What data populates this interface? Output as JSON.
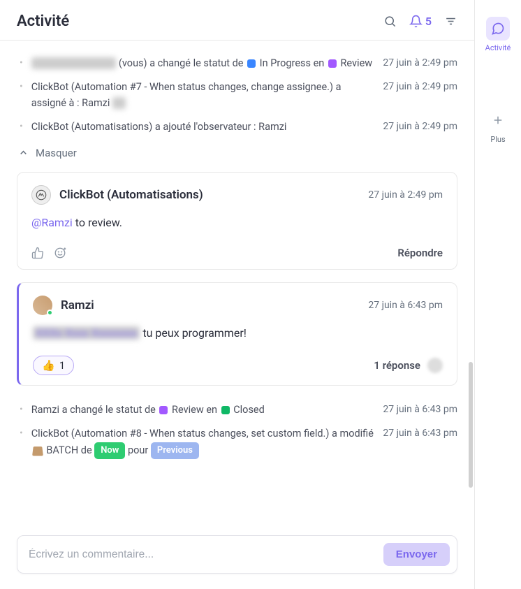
{
  "header": {
    "title": "Activité",
    "notif_count": "5"
  },
  "rail": {
    "activity_label": "Activité",
    "more_label": "Plus"
  },
  "hide_label": "Masquer",
  "activities_top": [
    {
      "prefix_blur": "Xx Xxxx Xxxxxxxx",
      "text_before": " (vous) a changé le statut de ",
      "dot1": "dot-blue",
      "status1": "In Progress",
      "mid": " en ",
      "dot2": "dot-purple",
      "status2": "Review",
      "time": "27 juin à 2:49 pm"
    },
    {
      "text": "ClickBot (Automation #7 - When status changes, change assignee.) a assigné à : Ramzi",
      "trailing_blur": true,
      "time": "27 juin à 2:49 pm"
    },
    {
      "text": "ClickBot (Automatisations) a ajouté l'observateur : Ramzi",
      "time": "27 juin à 2:49 pm"
    }
  ],
  "comment1": {
    "author": "ClickBot (Automatisations)",
    "time": "27 juin à 2:49 pm",
    "mention": "@Ramzi",
    "text": " to review.",
    "reply": "Répondre"
  },
  "comment2": {
    "author": "Ramzi",
    "time": "27 juin à 6:43 pm",
    "blur": "XXXx Xxxx Xxxxxxxx",
    "text": " tu peux programmer!",
    "reaction_emoji": "👍",
    "reaction_count": "1",
    "thread": "1 réponse"
  },
  "activities_bottom": [
    {
      "prefix": "Ramzi a changé le statut de ",
      "dot1": "dot-purple",
      "status1": "Review",
      "mid": " en ",
      "dot2": "dot-green",
      "status2": "Closed",
      "time": "27 juin à 6:43 pm"
    },
    {
      "prefix": "ClickBot (Automation #8 - When status changes, set custom field.) a modifié ",
      "batch": "BATCH",
      "mid": " de ",
      "badge1": "Now",
      "mid2": " pour ",
      "badge2": "Previous",
      "time": "27 juin à 6:43 pm"
    }
  ],
  "composer": {
    "placeholder": "Écrivez un commentaire...",
    "send": "Envoyer"
  }
}
